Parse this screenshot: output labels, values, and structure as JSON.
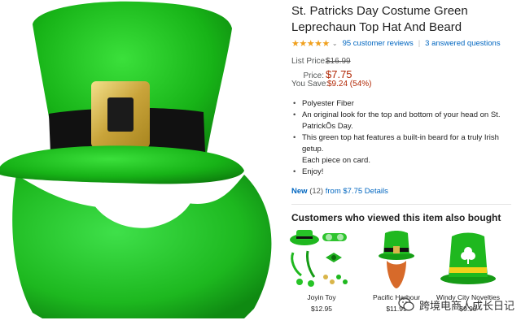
{
  "product": {
    "title_line1": "St. Patricks Day Costume Green",
    "title_line2": "Leprechaun Top Hat And Beard",
    "rating_icon": "star-icon",
    "review_count": "95 customer reviews",
    "answered_questions": "3 answered questions"
  },
  "pricing": {
    "list_price_label": "List Price:",
    "list_price": "$16.99",
    "price_label": "Price:",
    "price": "$7.75",
    "save_label": "You Save:",
    "save_amount": "$9.24 (54%)"
  },
  "features": [
    "Polyester Fiber",
    "An original look for the top and bottom of your head on St.",
    "PatrickÕs Day.",
    "This green top hat features a built-in beard for a truly Irish getup.",
    "Each piece on card.",
    "Enjoy!"
  ],
  "offers": {
    "new_label": "New",
    "new_count": "(12)",
    "from_text": "from $7.75",
    "details": "Details"
  },
  "also_bought": {
    "heading": "Customers who viewed this item also bought",
    "items": [
      {
        "name": "Joyin Toy",
        "price": "$12.95"
      },
      {
        "name": "Pacific Harbour",
        "price": "$11.99"
      },
      {
        "name": "Windy City Novelties",
        "price": "$9.99"
      }
    ]
  },
  "watermark": {
    "text": "跨境电商人成长日记"
  },
  "colors": {
    "link": "#0066c0",
    "price_red": "#b12704",
    "star": "#f0a01e",
    "hat_green": "#1fb81f"
  }
}
